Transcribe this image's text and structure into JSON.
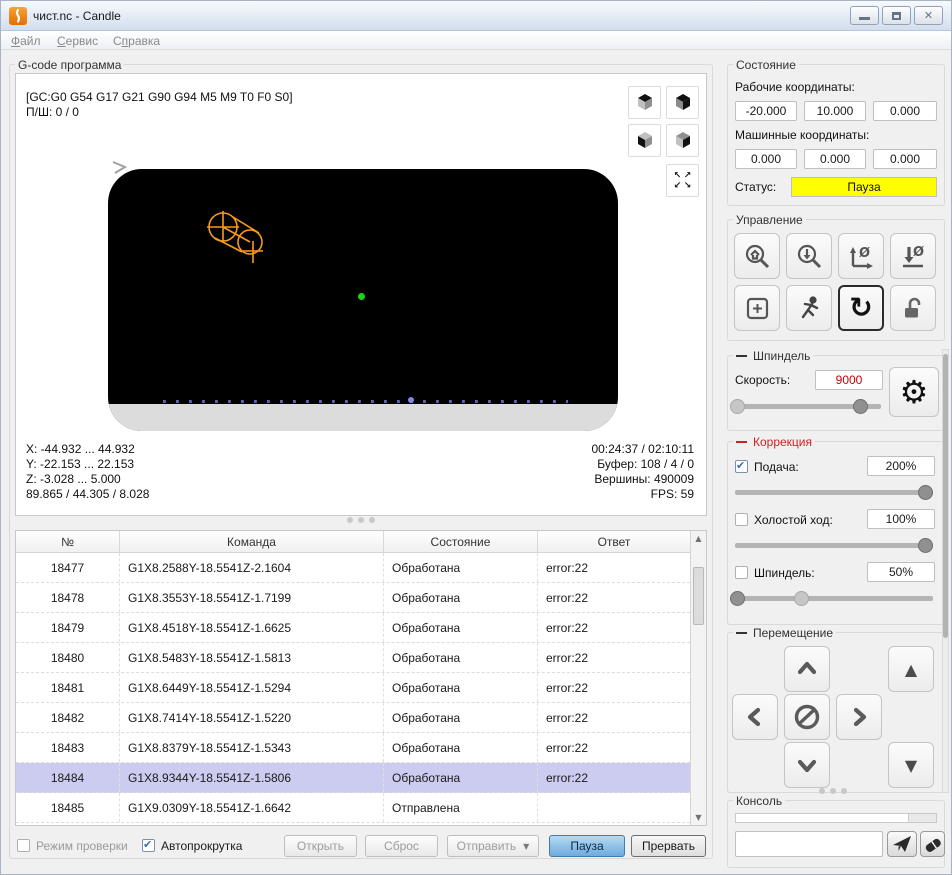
{
  "window": {
    "title": "чист.nc - Candle"
  },
  "menu": {
    "items": [
      {
        "pre": "",
        "accel": "Ф",
        "post": "айл"
      },
      {
        "pre": "",
        "accel": "С",
        "post": "ервис"
      },
      {
        "pre": "С",
        "accel": "п",
        "post": "равка"
      }
    ]
  },
  "viewer": {
    "group_title": "G-code программа",
    "parser_state": "[GC:G0 G54 G17 G21 G90 G94 M5 M9 T0 F0 S0]",
    "progress": "П/Ш: 0 / 0",
    "bounds_x": "X: -44.932 ... 44.932",
    "bounds_y": "Y: -22.153 ... 22.153",
    "bounds_z": "Z: -3.028 ... 5.000",
    "dimensions": "89.865 / 44.305 / 8.028",
    "time": "00:24:37 / 02:10:11",
    "buffer": "Буфер: 108 / 4 / 0",
    "vertices": "Вершины: 490009",
    "fps": "FPS: 59",
    "colors": {
      "toolpath_orange": "#f79b1e",
      "marker_green": "#17d417",
      "background": "#000000"
    }
  },
  "table": {
    "headers": [
      "№",
      "Команда",
      "Состояние",
      "Ответ"
    ],
    "rows": [
      {
        "n": "18477",
        "command": "G1X8.2588Y-18.5541Z-2.1604",
        "state": "Обработана",
        "response": "error:22",
        "selected": false
      },
      {
        "n": "18478",
        "command": "G1X8.3553Y-18.5541Z-1.7199",
        "state": "Обработана",
        "response": "error:22",
        "selected": false
      },
      {
        "n": "18479",
        "command": "G1X8.4518Y-18.5541Z-1.6625",
        "state": "Обработана",
        "response": "error:22",
        "selected": false
      },
      {
        "n": "18480",
        "command": "G1X8.5483Y-18.5541Z-1.5813",
        "state": "Обработана",
        "response": "error:22",
        "selected": false
      },
      {
        "n": "18481",
        "command": "G1X8.6449Y-18.5541Z-1.5294",
        "state": "Обработана",
        "response": "error:22",
        "selected": false
      },
      {
        "n": "18482",
        "command": "G1X8.7414Y-18.5541Z-1.5220",
        "state": "Обработана",
        "response": "error:22",
        "selected": false
      },
      {
        "n": "18483",
        "command": "G1X8.8379Y-18.5541Z-1.5343",
        "state": "Обработана",
        "response": "error:22",
        "selected": false
      },
      {
        "n": "18484",
        "command": "G1X8.9344Y-18.5541Z-1.5806",
        "state": "Обработана",
        "response": "error:22",
        "selected": true
      },
      {
        "n": "18485",
        "command": "G1X9.0309Y-18.5541Z-1.6642",
        "state": "Отправлена",
        "response": "",
        "selected": false
      }
    ],
    "selection_color": "#ccccf0"
  },
  "footer": {
    "check_mode_label": "Режим проверки",
    "check_mode_checked": false,
    "autoscroll_label": "Автопрокрутка",
    "autoscroll_checked": true,
    "open_label": "Открыть",
    "reset_label": "Сброс",
    "send_label": "Отправить",
    "pause_label": "Пауза",
    "abort_label": "Прервать",
    "pause_accent_color": "#6fabdc"
  },
  "state_panel": {
    "title": "Состояние",
    "work_label": "Рабочие координаты:",
    "work": [
      "-20.000",
      "10.000",
      "0.000"
    ],
    "machine_label": "Машинные координаты:",
    "machine": [
      "0.000",
      "0.000",
      "0.000"
    ],
    "status_label": "Статус:",
    "status_value": "Пауза",
    "status_color": "#ffff00"
  },
  "control_panel": {
    "title": "Управление"
  },
  "spindle_panel": {
    "title": "Шпиндель",
    "speed_label": "Скорость:",
    "speed_value": "9000",
    "speed_color": "#cc0000"
  },
  "override_panel": {
    "title": "Коррекция",
    "title_color": "#cc2222",
    "feed_label": "Подача:",
    "feed_value": "200%",
    "feed_checked": true,
    "rapid_label": "Холостой ход:",
    "rapid_value": "100%",
    "rapid_checked": false,
    "spindle_label": "Шпиндель:",
    "spindle_value": "50%",
    "spindle_checked": false
  },
  "jog_panel": {
    "title": "Перемещение"
  },
  "console_panel": {
    "title": "Консоль",
    "input_value": "",
    "input_placeholder": ""
  }
}
